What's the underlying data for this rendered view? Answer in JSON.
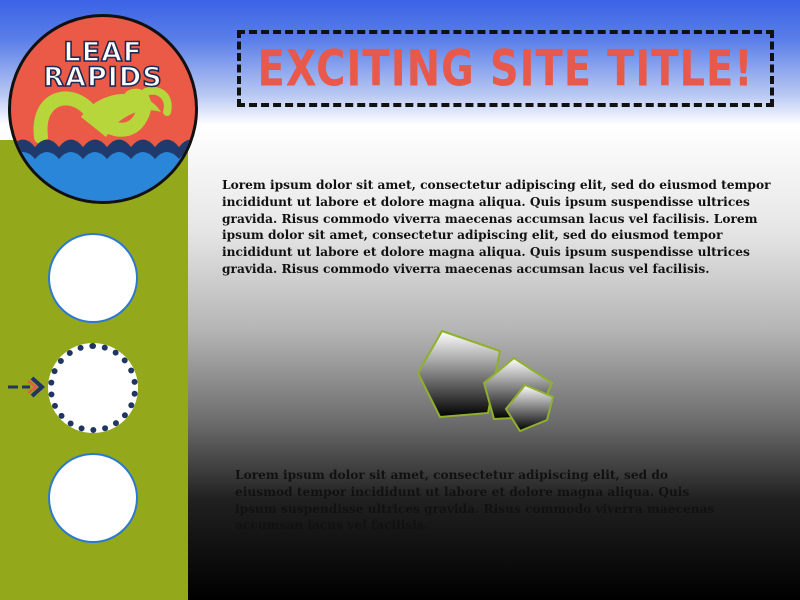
{
  "logo": {
    "line1": "LEAF",
    "line2": "RAPIDS",
    "colors": {
      "background": "#ea5a46",
      "leaf": "#b7d63b",
      "water": "#2a86d9",
      "water_dark": "#1f3b6e"
    },
    "icon": "leaf-wave-icon"
  },
  "header": {
    "title": "EXCITING SITE TITLE!",
    "title_color": "#e8594b"
  },
  "sidebar": {
    "color": "#94a81b",
    "nav_items": [
      {
        "name": "nav-circle-1",
        "selected": false
      },
      {
        "name": "nav-circle-2",
        "selected": true
      },
      {
        "name": "nav-circle-3",
        "selected": false
      }
    ],
    "selected_indicator_icon": "arrow-right-icon"
  },
  "content": {
    "paragraph1": "Lorem ipsum dolor sit amet, consectetur adipiscing elit, sed do eiusmod tempor incididunt ut labore et dolore magna aliqua. Quis ipsum suspendisse ultrices gravida. Risus commodo viverra maecenas accumsan lacus vel facilisis. Lorem ipsum dolor sit amet, consectetur adipiscing elit, sed do eiusmod tempor incididunt ut labore et dolore magna aliqua. Quis ipsum suspendisse ultrices gravida. Risus commodo viverra maecenas accumsan lacus vel facilisis.",
    "paragraph2": "Lorem ipsum dolor sit amet, consectetur adipiscing elit, sed do eiusmod tempor incididunt ut labore et dolore magna aliqua. Quis ipsum suspendisse ultrices gravida. Risus commodo viverra maecenas accumsan lacus vel facilisis.",
    "decoration_icon": "pentagons-icon"
  }
}
